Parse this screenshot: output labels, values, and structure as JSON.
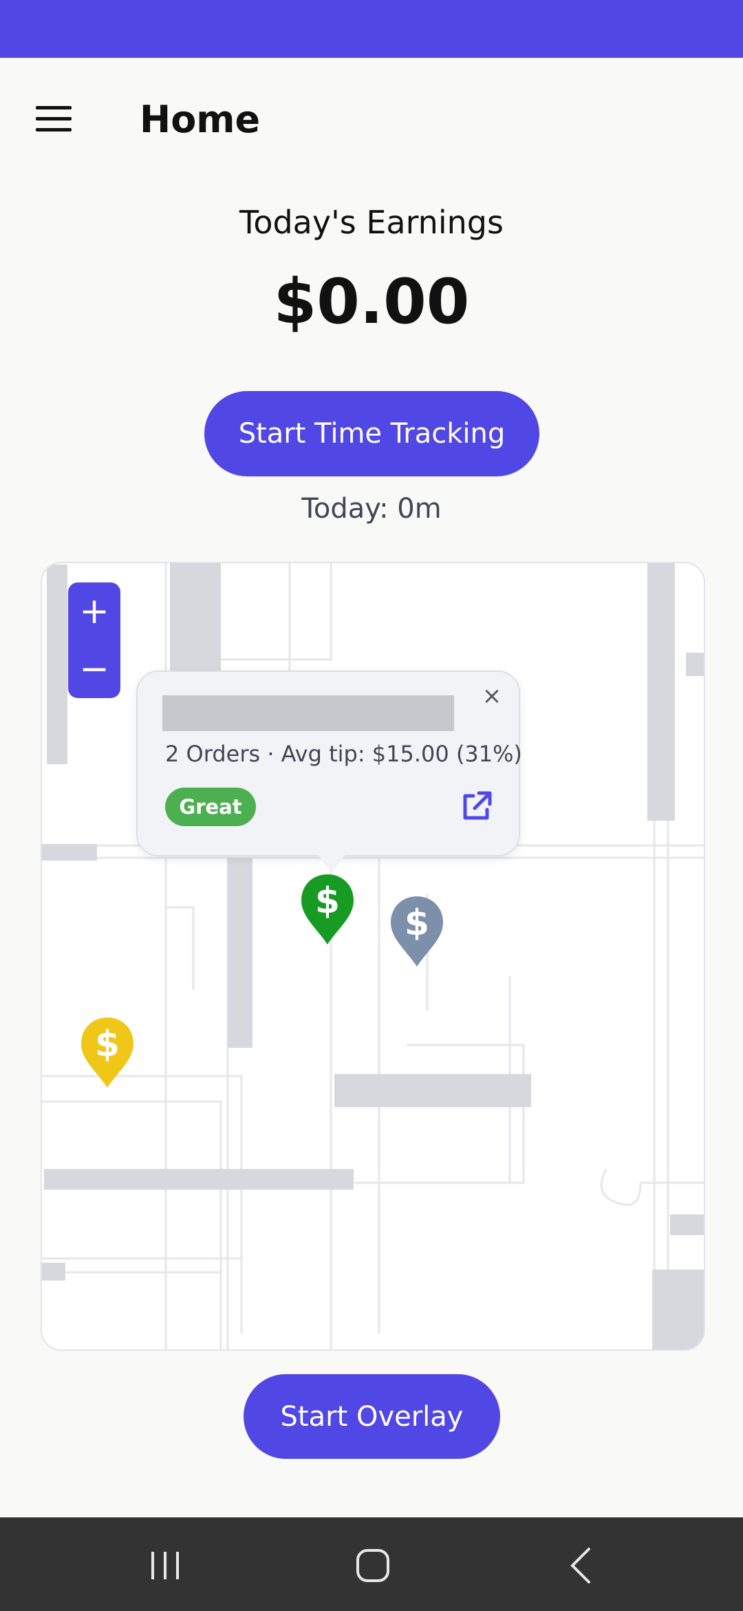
{
  "header": {
    "title": "Home"
  },
  "earnings": {
    "label": "Today's Earnings",
    "amount": "$0.00"
  },
  "actions": {
    "start_tracking": "Start Time Tracking",
    "start_overlay": "Start Overlay"
  },
  "tracking": {
    "today": "Today: 0m"
  },
  "map": {
    "zoom_in": "+",
    "zoom_out": "−",
    "popup": {
      "close": "×",
      "summary": "2 Orders · Avg tip: $15.00 (31%)",
      "rating": "Great",
      "rating_color": "#4caf50"
    },
    "pins": [
      {
        "name": "dollar-pin-green",
        "color": "#179b23"
      },
      {
        "name": "dollar-pin-gray",
        "color": "#7c8fab"
      },
      {
        "name": "dollar-pin-yellow",
        "color": "#f0c619"
      }
    ]
  },
  "colors": {
    "accent": "#5147e5",
    "nav_bar": "#333333"
  },
  "icons": [
    "menu-icon",
    "open-link-icon",
    "recent-apps-icon",
    "home-icon",
    "back-icon"
  ]
}
